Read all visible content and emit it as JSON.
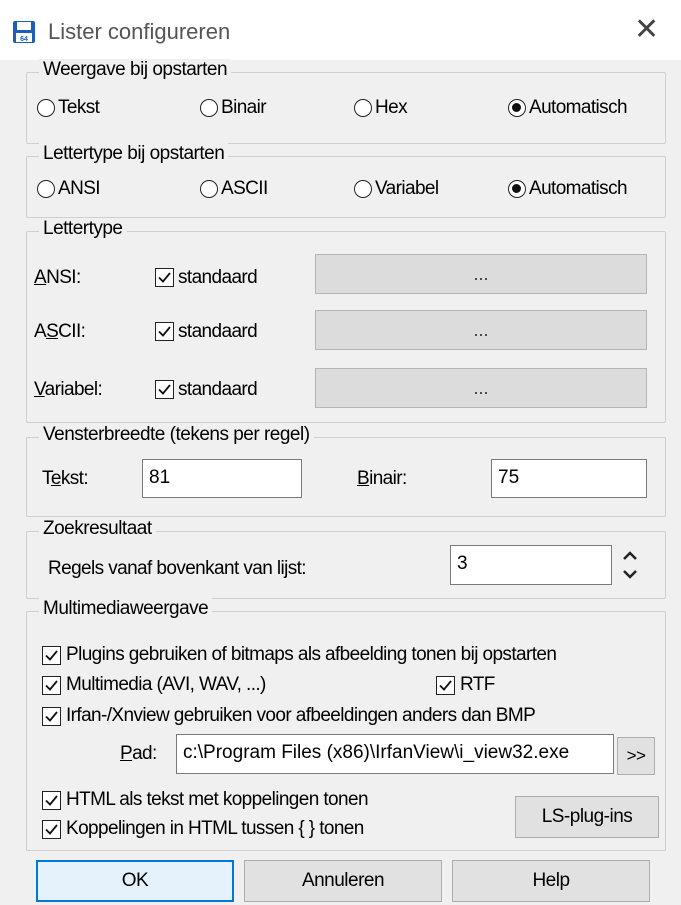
{
  "window": {
    "title": "Lister configureren",
    "close_icon": "close-icon"
  },
  "weergave": {
    "legend": "Weergave bij opstarten",
    "options": [
      {
        "label": "Tekst",
        "selected": false
      },
      {
        "label": "Binair",
        "selected": false
      },
      {
        "label": "Hex",
        "selected": false
      },
      {
        "label": "Automatisch",
        "selected": true
      }
    ]
  },
  "lettertype_opstart": {
    "legend": "Lettertype bij opstarten",
    "options": [
      {
        "label": "ANSI",
        "selected": false
      },
      {
        "label": "ASCII",
        "selected": false
      },
      {
        "label": "Variabel",
        "selected": false
      },
      {
        "label": "Automatisch",
        "selected": true
      }
    ]
  },
  "lettertype": {
    "legend": "Lettertype",
    "rows": [
      {
        "key": "A",
        "rest": "NSI:",
        "check_label": "standaard",
        "checked": true,
        "button": "..."
      },
      {
        "pre": "A",
        "key": "S",
        "rest": "CII:",
        "check_label": "standaard",
        "checked": true,
        "button": "..."
      },
      {
        "key": "V",
        "rest": "ariabel:",
        "check_label": "standaard",
        "checked": true,
        "button": "..."
      }
    ]
  },
  "vensterbreedte": {
    "legend": "Vensterbreedte (tekens per regel)",
    "tekst_pre": "T",
    "tekst_key": "e",
    "tekst_rest": "kst:",
    "tekst_value": "81",
    "binair_key": "B",
    "binair_rest": "inair:",
    "binair_value": "75"
  },
  "zoekresultaat": {
    "legend": "Zoekresultaat",
    "label": "Regels vanaf bovenkant van lijst:",
    "value": "3"
  },
  "multimedia": {
    "legend": "Multimediaweergave",
    "plugins_label": "Plugins gebruiken of bitmaps als afbeelding tonen bij opstarten",
    "multimedia_label": "Multimedia (AVI, WAV, ...)",
    "rtf_label": "RTF",
    "irfan_label": "Irfan-/Xnview gebruiken voor afbeeldingen anders dan BMP",
    "pad_key": "P",
    "pad_rest": "ad:",
    "pad_value": "c:\\Program Files (x86)\\IrfanView\\i_view32.exe",
    "browse_label": ">>",
    "html_label": "HTML als tekst met koppelingen tonen",
    "koppelingen_label": "Koppelingen in HTML tussen { } tonen",
    "lsplugins_label": "LS-plug-ins"
  },
  "buttons": {
    "ok": "OK",
    "annuleren": "Annuleren",
    "help": "Help"
  }
}
